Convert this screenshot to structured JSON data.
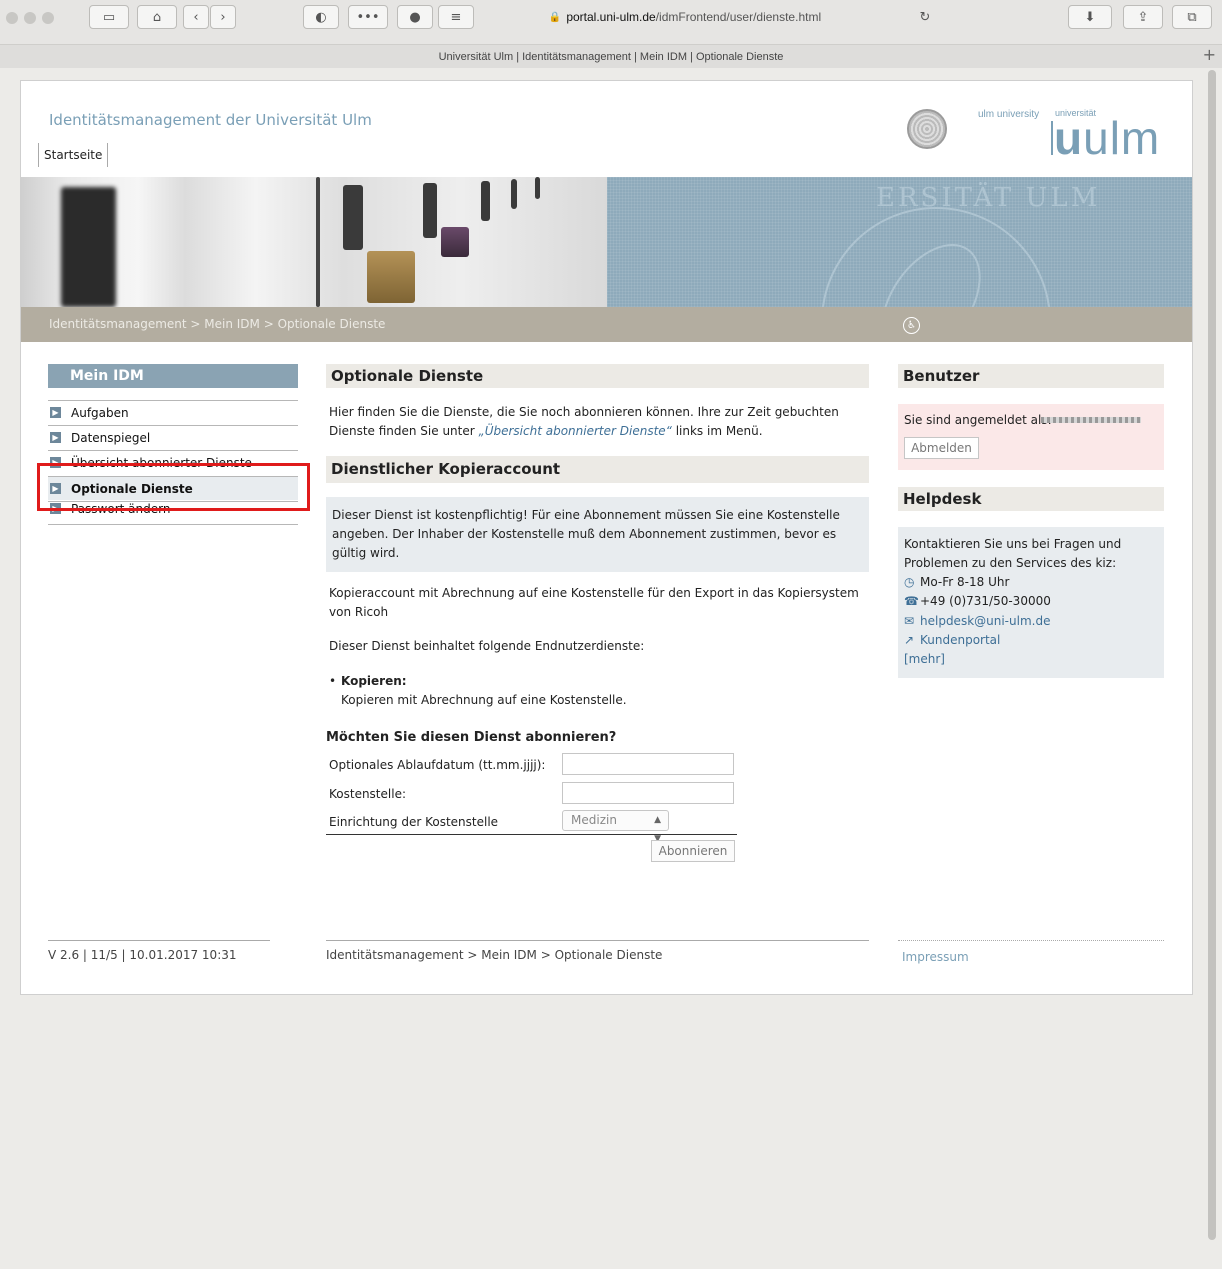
{
  "browser": {
    "url_domain": "portal.uni-ulm.de",
    "url_path": "/idmFrontend/user/dienste.html",
    "tab_title": "Universität Ulm | Identitätsmanagement | Mein IDM | Optionale Dienste"
  },
  "header": {
    "site_title": "Identitätsmanagement der Universität Ulm",
    "startseite": "Startseite",
    "logo_small": "ulm university",
    "logo_uni": "universität",
    "logo_big_bold": "u",
    "logo_big": "ulm",
    "seal_text": "ERSITÄT ULM"
  },
  "breadcrumb": "Identitätsmanagement > Mein IDM > Optionale Dienste",
  "sidebar": {
    "title": "Mein IDM",
    "items": [
      {
        "label": "Aufgaben"
      },
      {
        "label": "Datenspiegel"
      },
      {
        "label": "Übersicht abonnierter Dienste"
      },
      {
        "label": "Optionale Dienste"
      },
      {
        "label": "Passwort ändern"
      }
    ]
  },
  "main": {
    "heading": "Optionale Dienste",
    "intro_1": "Hier finden Sie die Dienste, die Sie noch abonnieren können. Ihre zur Zeit gebuchten",
    "intro_2a": "Dienste finden Sie unter ",
    "intro_link": "„Übersicht abonnierter Dienste“",
    "intro_2b": " links im Menü.",
    "service_heading": "Dienstlicher Kopieraccount",
    "notice": "Dieser Dienst ist kostenpflichtig! Für eine Abonnement müssen Sie eine Kostenstelle angeben. Der Inhaber der Kostenstelle muß dem Abonnement zustimmen, bevor es gültig wird.",
    "description_1": "Kopieraccount mit Abrechnung auf eine Kostenstelle für den Export in das Kopiersystem",
    "description_2": "von Ricoh",
    "includes": "Dieser Dienst beinhaltet folgende Endnutzerdienste:",
    "bullet_title": "Kopieren:",
    "bullet_text": "Kopieren mit Abrechnung auf eine Kostenstelle.",
    "question": "Möchten Sie diesen Dienst abonnieren?",
    "form": {
      "expiry_label": "Optionales Ablaufdatum (tt.mm.jjjj):",
      "expiry_value": "",
      "cost_label": "Kostenstelle:",
      "cost_value": "",
      "institution_label": "Einrichtung der Kostenstelle",
      "institution_value": "Medizin",
      "submit": "Abonnieren"
    }
  },
  "benutzer": {
    "heading": "Benutzer",
    "logged_in": "Sie sind angemeldet als:",
    "logout": "Abmelden"
  },
  "helpdesk": {
    "heading": "Helpdesk",
    "text_1": "Kontaktieren Sie uns bei Fragen und",
    "text_2": "Problemen zu den Services des kiz:",
    "hours": "Mo-Fr  8-18 Uhr",
    "phone": "+49 (0)731/50-30000",
    "email": "helpdesk@uni-ulm.de",
    "portal": "Kundenportal",
    "more": "[mehr]"
  },
  "footer": {
    "version": "V 2.6 | 11/5 | 10.01.2017 10:31",
    "breadcrumb": "Identitätsmanagement > Mein IDM > Optionale Dienste",
    "impressum": "Impressum"
  }
}
